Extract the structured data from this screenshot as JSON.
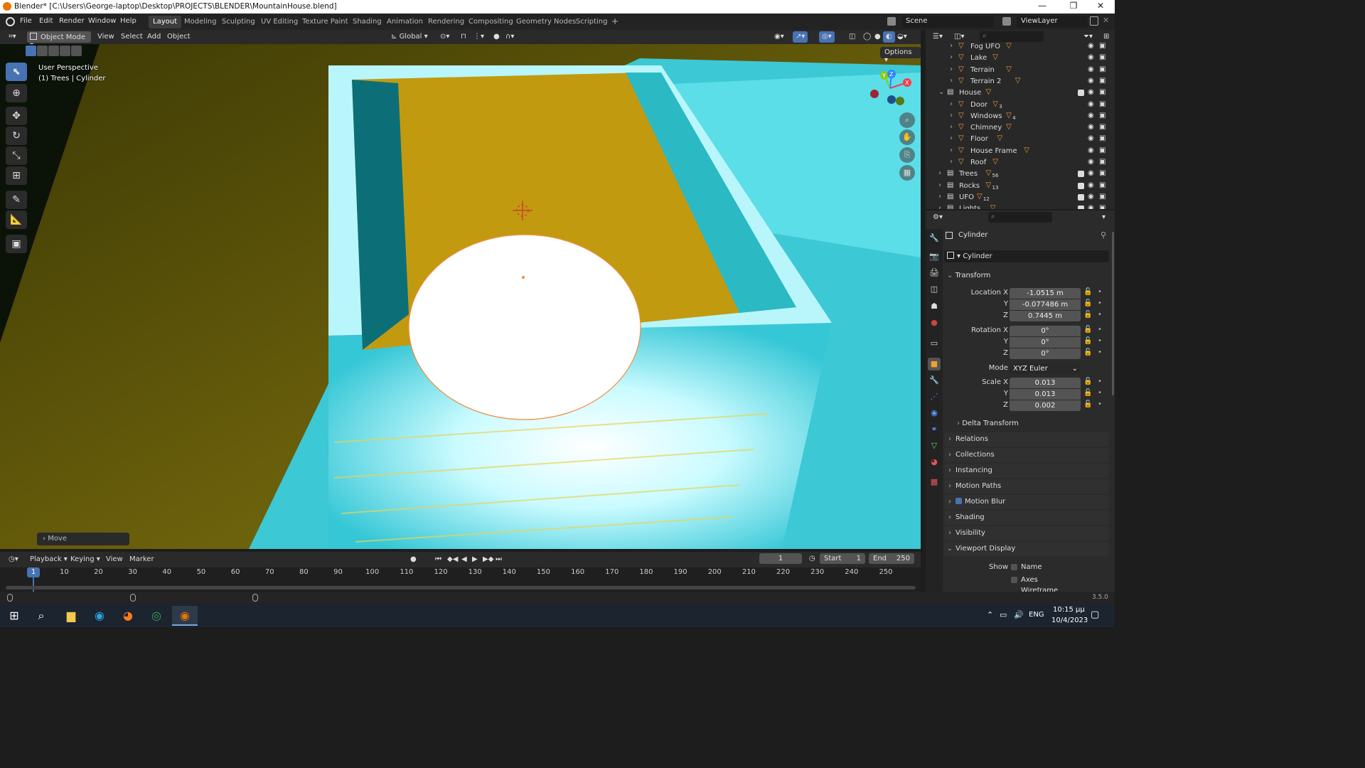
{
  "titlebar": {
    "title": "Blender* [C:\\Users\\George-laptop\\Desktop\\PROJECTS\\BLENDER\\MountainHouse.blend]",
    "min": "—",
    "max": "❐",
    "close": "✕"
  },
  "menubar": {
    "menus": [
      "File",
      "Edit",
      "Render",
      "Window",
      "Help"
    ],
    "workspaces": [
      "Layout",
      "Modeling",
      "Sculpting",
      "UV Editing",
      "Texture Paint",
      "Shading",
      "Animation",
      "Rendering",
      "Compositing",
      "Geometry Nodes",
      "Scripting"
    ],
    "add_tab": "+",
    "scene": "Scene",
    "view_layer": "ViewLayer"
  },
  "viewport_header": {
    "mode": "Object Mode",
    "menus": [
      "View",
      "Select",
      "Add",
      "Object"
    ],
    "orientation": "Global",
    "options": "Options"
  },
  "viewport": {
    "perspective": "User Perspective",
    "context": "(1) Trees | Cylinder",
    "last_op": "Move",
    "gizmo_axes": {
      "x": "X",
      "y": "Y",
      "z": "Z"
    }
  },
  "timeline": {
    "menus": [
      "Playback",
      "Keying",
      "View",
      "Marker"
    ],
    "current_frame": "1",
    "start_label": "Start",
    "start": "1",
    "end_label": "End",
    "end": "250",
    "ruler": [
      "1",
      "10",
      "20",
      "30",
      "40",
      "50",
      "60",
      "70",
      "80",
      "90",
      "100",
      "110",
      "120",
      "130",
      "140",
      "150",
      "160",
      "170",
      "180",
      "190",
      "200",
      "210",
      "220",
      "230",
      "240",
      "250"
    ]
  },
  "outliner": {
    "items": [
      {
        "name": "Fog UFO",
        "sub": ""
      },
      {
        "name": "Lake",
        "sub": ""
      },
      {
        "name": "Terrain",
        "sub": ""
      },
      {
        "name": "Terrain 2",
        "sub": ""
      },
      {
        "name": "House",
        "sub": ""
      },
      {
        "name": "Door",
        "sub": "3"
      },
      {
        "name": "Windows",
        "sub": "4"
      },
      {
        "name": "Chimney",
        "sub": ""
      },
      {
        "name": "Floor",
        "sub": ""
      },
      {
        "name": "House Frame",
        "sub": ""
      },
      {
        "name": "Roof",
        "sub": ""
      },
      {
        "name": "Trees",
        "sub": "56"
      },
      {
        "name": "Rocks",
        "sub": "13"
      },
      {
        "name": "UFO",
        "sub": "12"
      },
      {
        "name": "Lights",
        "sub": ""
      }
    ]
  },
  "properties": {
    "object_name": "Cylinder",
    "data_name": "Cylinder",
    "transform": {
      "title": "Transform",
      "location_x_label": "Location X",
      "location_x": "-1.0515 m",
      "location_y_label": "Y",
      "location_y": "-0.077486 m",
      "location_z_label": "Z",
      "location_z": "0.7445 m",
      "rotation_x_label": "Rotation X",
      "rotation_x": "0°",
      "rotation_y_label": "Y",
      "rotation_y": "0°",
      "rotation_z_label": "Z",
      "rotation_z": "0°",
      "mode_label": "Mode",
      "mode": "XYZ Euler",
      "scale_x_label": "Scale X",
      "scale_x": "0.013",
      "scale_y_label": "Y",
      "scale_y": "0.013",
      "scale_z_label": "Z",
      "scale_z": "0.002",
      "delta": "Delta Transform"
    },
    "sections": [
      "Relations",
      "Collections",
      "Instancing",
      "Motion Paths",
      "Motion Blur",
      "Shading",
      "Visibility",
      "Viewport Display"
    ],
    "viewport_display": {
      "show_label": "Show",
      "name": "Name",
      "axes": "Axes",
      "wireframe": "Wireframe"
    }
  },
  "statusbar": {
    "version": "3.5.0"
  },
  "taskbar": {
    "lang": "ENG",
    "time": "10:15 μμ",
    "date": "10/4/2023"
  },
  "colors": {
    "accent": "#4772b3",
    "selection": "#f08c3c",
    "viewport_cyan": "#5fe8f0",
    "viewport_yellow": "#d9a800"
  }
}
